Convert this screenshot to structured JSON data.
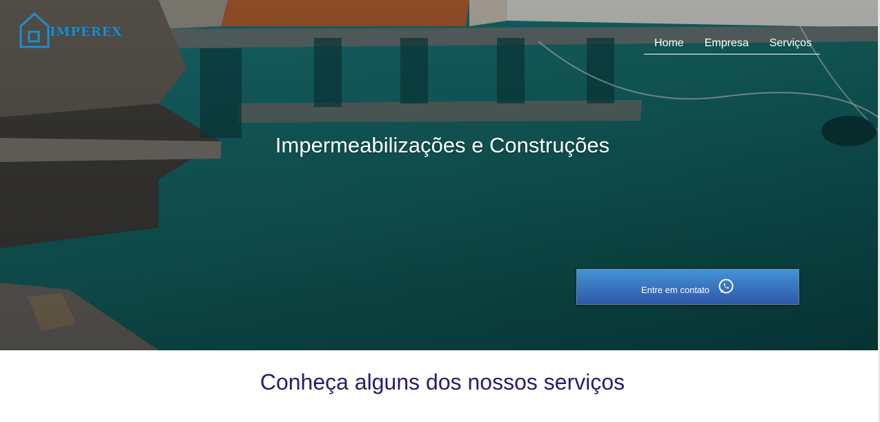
{
  "brand": {
    "logo_text": "IMPEREX",
    "logo_color": "#1b8fd0"
  },
  "nav": {
    "items": [
      {
        "label": "Home"
      },
      {
        "label": "Empresa"
      },
      {
        "label": "Serviços"
      }
    ]
  },
  "hero": {
    "title": "Impermeabilizações e Construções",
    "contact_button": {
      "label": "Entre em contato",
      "icon": "whatsapp-icon",
      "color_top": "#4393d7",
      "color_bottom": "#2f57a8"
    }
  },
  "services": {
    "heading": "Conheça alguns dos nossos serviços",
    "heading_color": "#231f6b"
  }
}
